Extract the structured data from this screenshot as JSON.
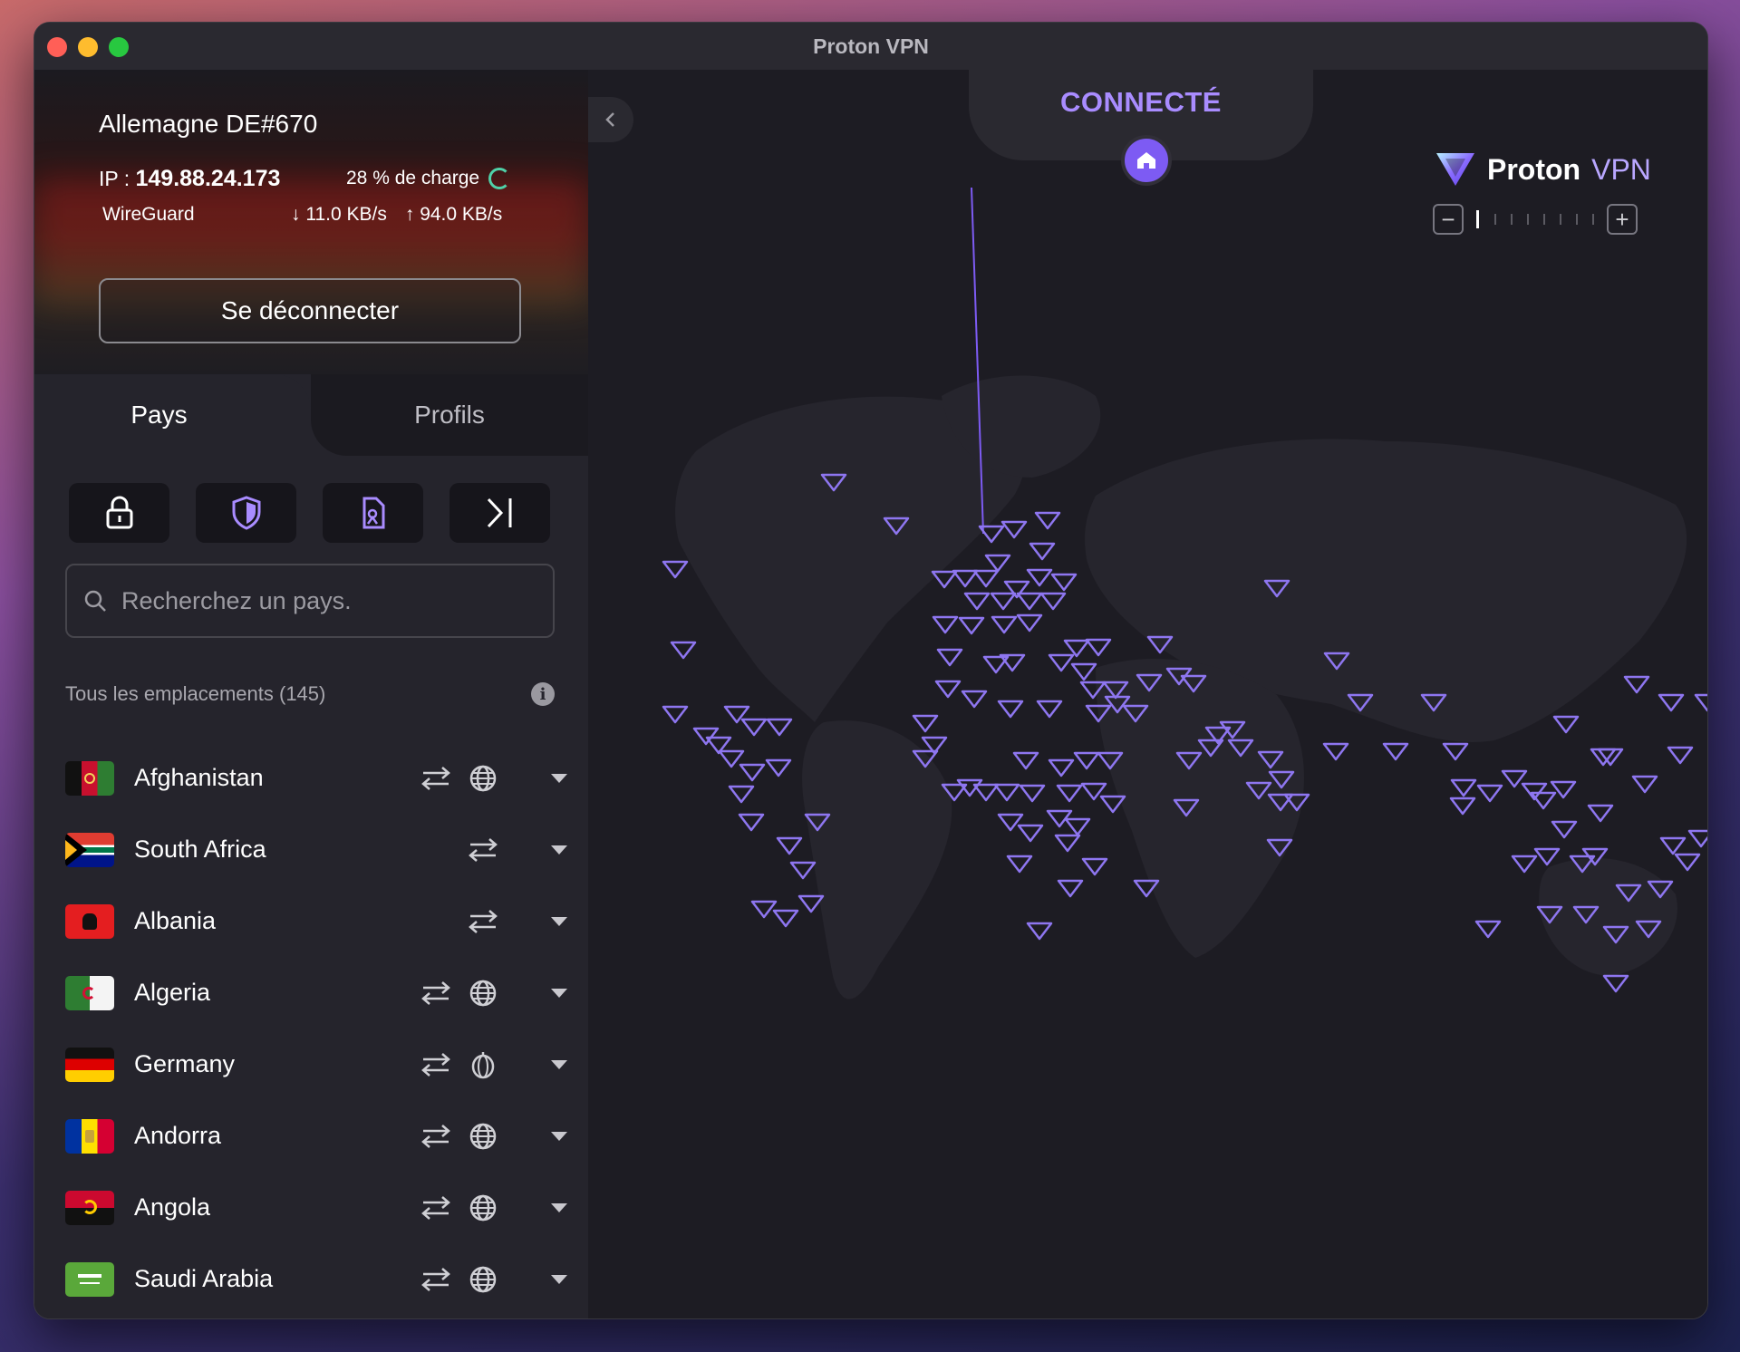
{
  "window": {
    "title": "Proton VPN"
  },
  "connection": {
    "server": "Allemagne DE#670",
    "ip_label": "IP :",
    "ip": "149.88.24.173",
    "load": "28 % de charge",
    "protocol": "WireGuard",
    "download": "11.0 KB/s",
    "upload": "94.0 KB/s",
    "disconnect_label": "Se déconnecter"
  },
  "tabs": {
    "countries": "Pays",
    "profiles": "Profils"
  },
  "search": {
    "placeholder": "Recherchez un pays."
  },
  "locations": {
    "header": "Tous les emplacements (145)",
    "countries": [
      {
        "name": "Afghanistan",
        "features": [
          "p2p",
          "tor-globe"
        ]
      },
      {
        "name": "South Africa",
        "features": [
          "p2p"
        ]
      },
      {
        "name": "Albania",
        "features": [
          "p2p"
        ]
      },
      {
        "name": "Algeria",
        "features": [
          "p2p",
          "tor-globe"
        ]
      },
      {
        "name": "Germany",
        "features": [
          "p2p",
          "tor"
        ]
      },
      {
        "name": "Andorra",
        "features": [
          "p2p",
          "tor-globe"
        ]
      },
      {
        "name": "Angola",
        "features": [
          "p2p",
          "tor-globe"
        ]
      },
      {
        "name": "Saudi Arabia",
        "features": [
          "p2p",
          "tor-globe"
        ]
      }
    ]
  },
  "map": {
    "status": "CONNECTÉ",
    "brand_name": "Proton",
    "brand_suffix": "VPN",
    "accent": "#7d5bf3",
    "marker_color": "#8e76f0"
  },
  "icons": {
    "filters": [
      "lock-icon",
      "shield-icon",
      "streaming-icon",
      "secure-core-icon"
    ],
    "feature_p2p": "arrows-exchange-icon",
    "feature_globe": "globe-icon"
  }
}
